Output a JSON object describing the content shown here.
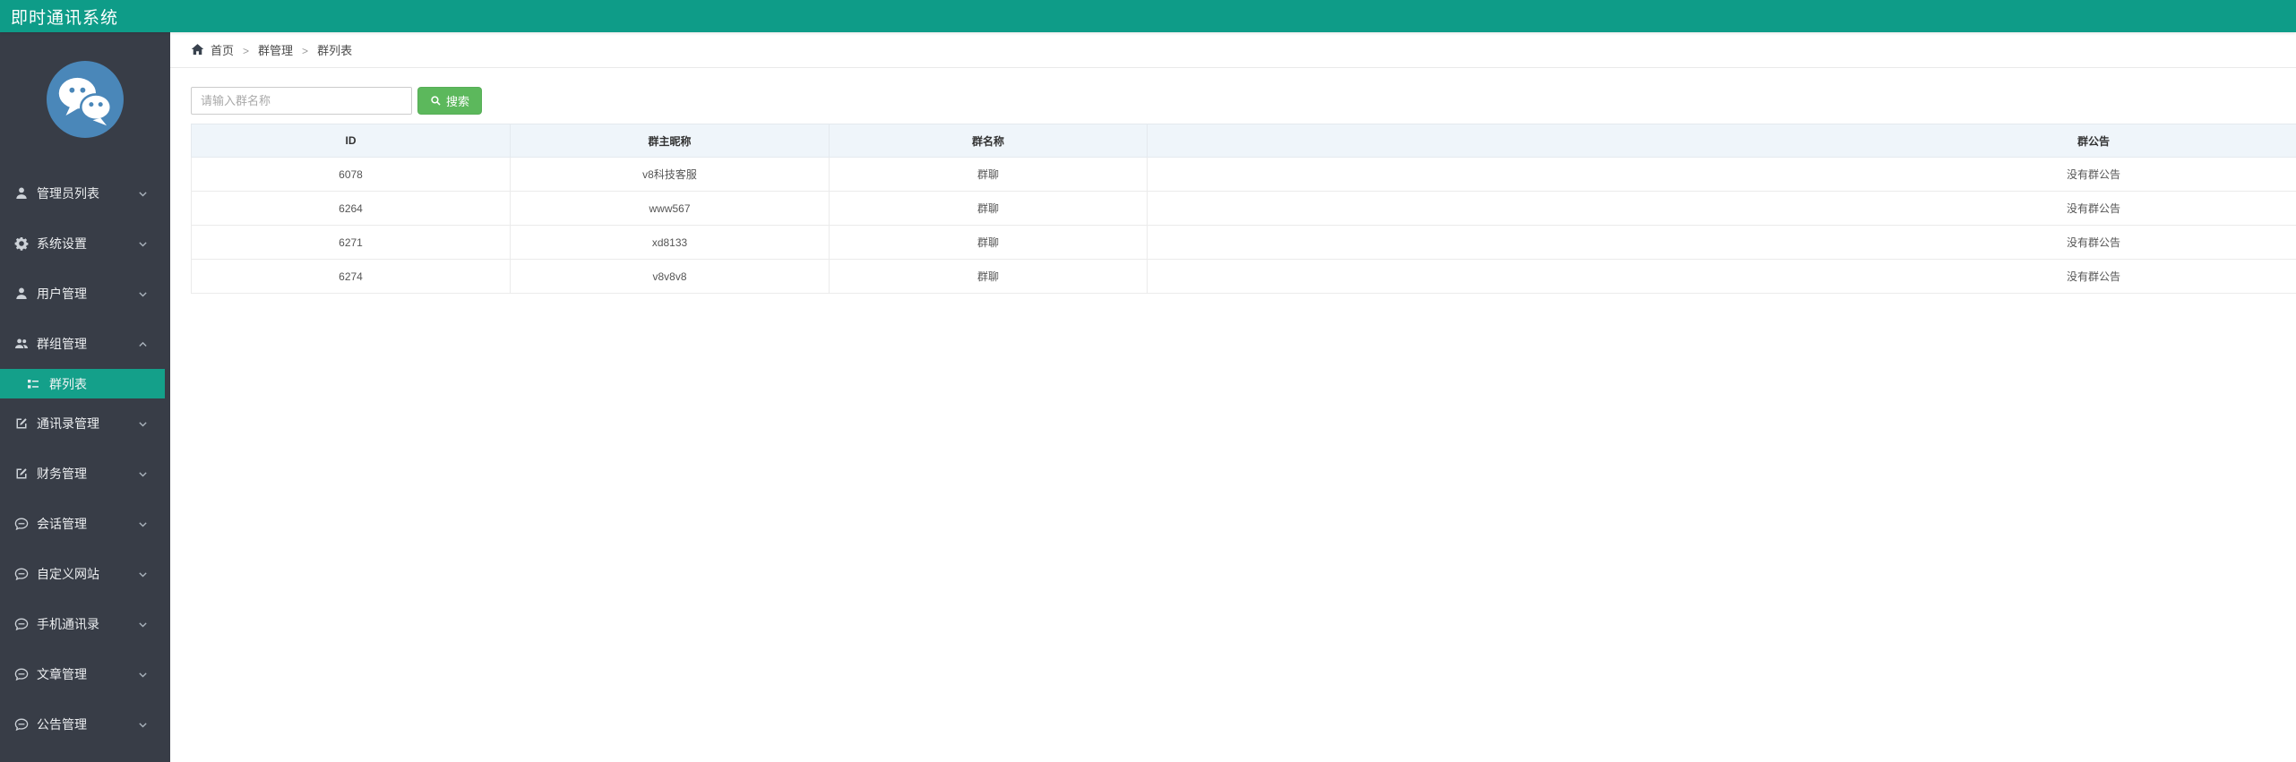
{
  "topbar": {
    "title": "即时通讯系统"
  },
  "sidebar": {
    "items": [
      {
        "label": "管理员列表",
        "icon": "user"
      },
      {
        "label": "系统设置",
        "icon": "gear"
      },
      {
        "label": "用户管理",
        "icon": "user"
      },
      {
        "label": "群组管理",
        "icon": "users",
        "expanded": true,
        "children": [
          {
            "label": "群列表",
            "icon": "list",
            "active": true
          }
        ]
      },
      {
        "label": "通讯录管理",
        "icon": "edit"
      },
      {
        "label": "财务管理",
        "icon": "edit"
      },
      {
        "label": "会话管理",
        "icon": "comment"
      },
      {
        "label": "自定义网站",
        "icon": "comment"
      },
      {
        "label": "手机通讯录",
        "icon": "comment"
      },
      {
        "label": "文章管理",
        "icon": "comment"
      },
      {
        "label": "公告管理",
        "icon": "comment"
      }
    ]
  },
  "breadcrumb": {
    "items": [
      "首页",
      "群管理",
      "群列表"
    ],
    "separator": ">"
  },
  "search": {
    "placeholder": "请输入群名称",
    "button_label": "搜索"
  },
  "table": {
    "columns": [
      "ID",
      "群主昵称",
      "群名称",
      "群公告"
    ],
    "rows": [
      [
        "6078",
        "v8科技客服",
        "群聊",
        "没有群公告"
      ],
      [
        "6264",
        "www567",
        "群聊",
        "没有群公告"
      ],
      [
        "6271",
        "xd8133",
        "群聊",
        "没有群公告"
      ],
      [
        "6274",
        "v8v8v8",
        "群聊",
        "没有群公告"
      ]
    ]
  },
  "colors": {
    "topbar": "#0e9c88",
    "sidebar": "#383d47",
    "active": "#14a08a",
    "button": "#5cb85c",
    "header_bg": "#eff5fa",
    "logo": "#4a87b9"
  }
}
